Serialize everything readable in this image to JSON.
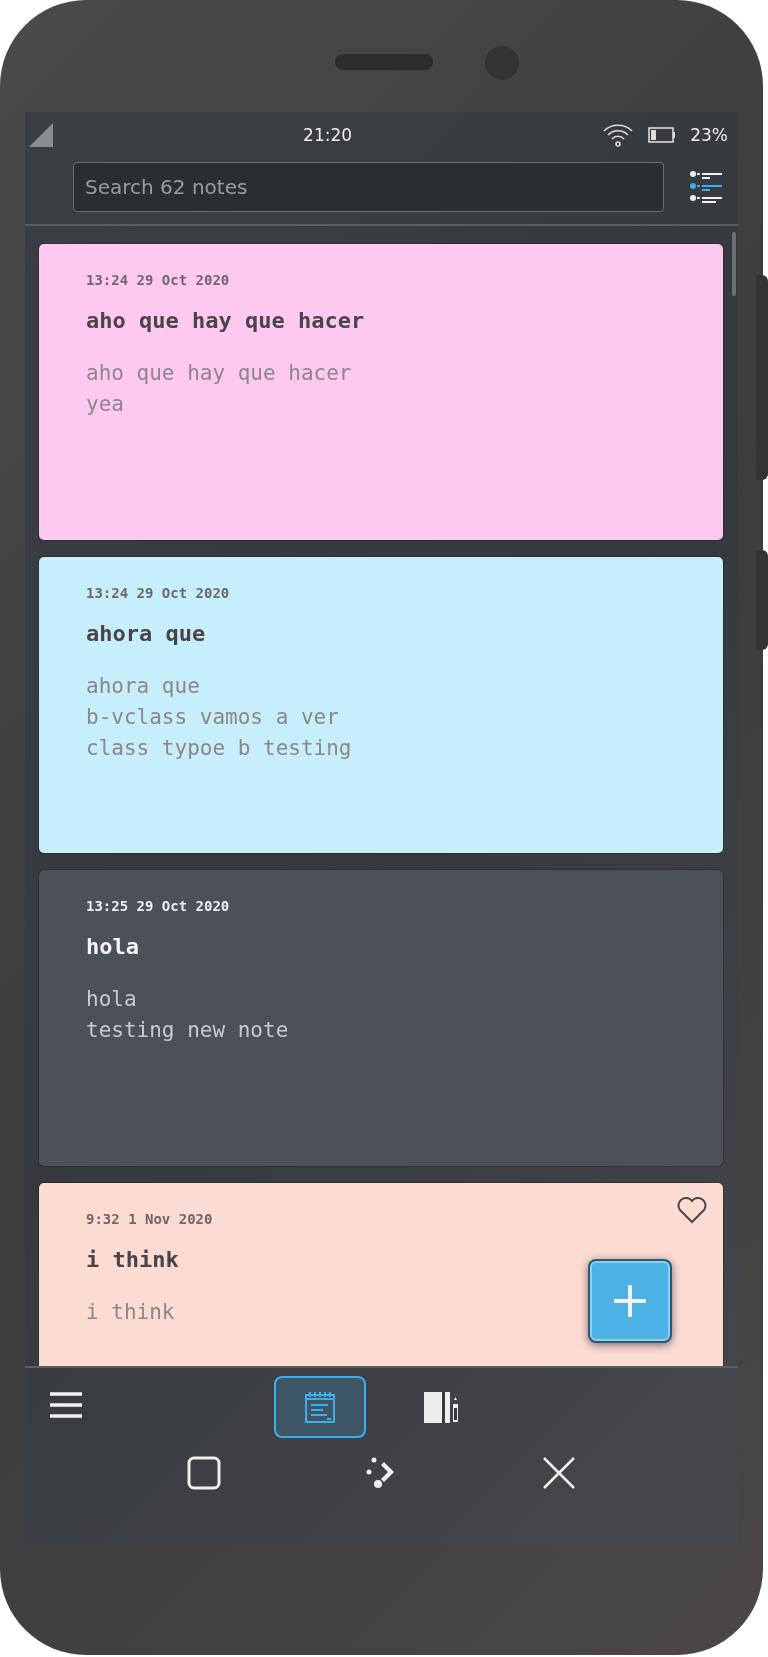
{
  "status_bar": {
    "time": "21:20",
    "battery": "23%"
  },
  "search": {
    "placeholder": "Search 62 notes"
  },
  "notes": [
    {
      "time": "13:24 29 Oct 2020",
      "title": "aho que hay que hacer",
      "body": [
        "aho que hay que hacer",
        "yea"
      ],
      "color": "#fdc9f1",
      "favorite": false
    },
    {
      "time": "13:24 29 Oct 2020",
      "title": "ahora que",
      "body": [
        "ahora que",
        "b-vclass vamos a ver",
        "class typoe b testing"
      ],
      "color": "#c7eefb",
      "favorite": false
    },
    {
      "time": "13:25 29 Oct 2020",
      "title": "hola",
      "body": [
        "hola",
        "testing new note"
      ],
      "color": "#4b5059",
      "favorite": false
    },
    {
      "time": "9:32 1 Nov 2020",
      "title": "i think",
      "body": [
        "i think"
      ],
      "color": "#fcdbd3",
      "favorite": true
    }
  ],
  "tabs": [
    {
      "kind": "notes",
      "selected": true
    },
    {
      "kind": "notebooks",
      "selected": false
    }
  ]
}
